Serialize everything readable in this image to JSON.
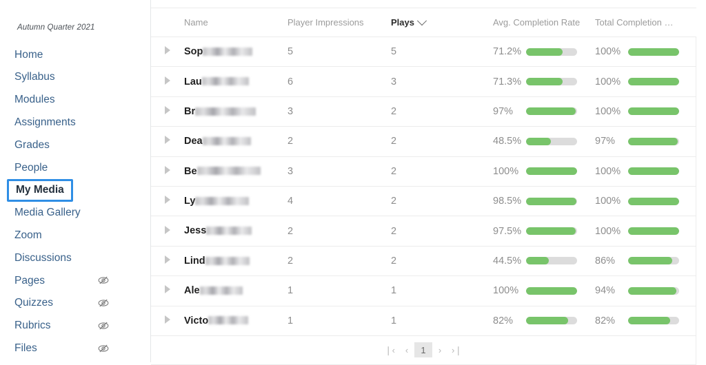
{
  "sidebar": {
    "term_label": "Autumn Quarter 2021",
    "items": [
      {
        "label": "Home",
        "hidden_icon": "",
        "active": false
      },
      {
        "label": "Syllabus",
        "hidden_icon": "",
        "active": false
      },
      {
        "label": "Modules",
        "hidden_icon": "",
        "active": false
      },
      {
        "label": "Assignments",
        "hidden_icon": "",
        "active": false
      },
      {
        "label": "Grades",
        "hidden_icon": "",
        "active": false
      },
      {
        "label": "People",
        "hidden_icon": "",
        "active": false
      },
      {
        "label": "My Media",
        "hidden_icon": "",
        "active": true
      },
      {
        "label": "Media Gallery",
        "hidden_icon": "",
        "active": false
      },
      {
        "label": "Zoom",
        "hidden_icon": "",
        "active": false
      },
      {
        "label": "Discussions",
        "hidden_icon": "",
        "active": false
      },
      {
        "label": "Pages",
        "hidden_icon": "eye-slash-icon",
        "active": false
      },
      {
        "label": "Quizzes",
        "hidden_icon": "eye-slash-icon",
        "active": false
      },
      {
        "label": "Rubrics",
        "hidden_icon": "eye-slash-icon",
        "active": false
      },
      {
        "label": "Files",
        "hidden_icon": "eye-slash-icon",
        "active": false
      }
    ]
  },
  "table": {
    "columns": [
      {
        "key": "toggle",
        "label": "",
        "sorted": false
      },
      {
        "key": "name",
        "label": "Name",
        "sorted": false
      },
      {
        "key": "impressions",
        "label": "Player Impressions",
        "sorted": false
      },
      {
        "key": "plays",
        "label": "Plays",
        "sorted": true,
        "sort_icon": "chevron-down-icon"
      },
      {
        "key": "avg",
        "label": "Avg. Completion Rate",
        "sorted": false
      },
      {
        "key": "total",
        "label": "Total Completion …",
        "sorted": false
      }
    ],
    "rows": [
      {
        "toggle_icon": "expand-triangle-icon",
        "name_visible": "Sop",
        "name_redacted_width": 72,
        "impressions": "5",
        "plays": "5",
        "avg_completion": "71.2%",
        "avg_value": 71.2,
        "total_completion": "100%",
        "total_value": 100
      },
      {
        "toggle_icon": "expand-triangle-icon",
        "name_visible": "Lau",
        "name_redacted_width": 68,
        "impressions": "6",
        "plays": "3",
        "avg_completion": "71.3%",
        "avg_value": 71.3,
        "total_completion": "100%",
        "total_value": 100
      },
      {
        "toggle_icon": "expand-triangle-icon",
        "name_visible": "Br",
        "name_redacted_width": 88,
        "impressions": "3",
        "plays": "2",
        "avg_completion": "97%",
        "avg_value": 97,
        "total_completion": "100%",
        "total_value": 100
      },
      {
        "toggle_icon": "expand-triangle-icon",
        "name_visible": "Dea",
        "name_redacted_width": 70,
        "impressions": "2",
        "plays": "2",
        "avg_completion": "48.5%",
        "avg_value": 48.5,
        "total_completion": "97%",
        "total_value": 97
      },
      {
        "toggle_icon": "expand-triangle-icon",
        "name_visible": "Be",
        "name_redacted_width": 92,
        "impressions": "3",
        "plays": "2",
        "avg_completion": "100%",
        "avg_value": 100,
        "total_completion": "100%",
        "total_value": 100
      },
      {
        "toggle_icon": "expand-triangle-icon",
        "name_visible": "Ly",
        "name_redacted_width": 78,
        "impressions": "4",
        "plays": "2",
        "avg_completion": "98.5%",
        "avg_value": 98.5,
        "total_completion": "100%",
        "total_value": 100
      },
      {
        "toggle_icon": "expand-triangle-icon",
        "name_visible": "Jess",
        "name_redacted_width": 66,
        "impressions": "2",
        "plays": "2",
        "avg_completion": "97.5%",
        "avg_value": 97.5,
        "total_completion": "100%",
        "total_value": 100
      },
      {
        "toggle_icon": "expand-triangle-icon",
        "name_visible": "Lind",
        "name_redacted_width": 64,
        "impressions": "2",
        "plays": "2",
        "avg_completion": "44.5%",
        "avg_value": 44.5,
        "total_completion": "86%",
        "total_value": 86
      },
      {
        "toggle_icon": "expand-triangle-icon",
        "name_visible": "Ale",
        "name_redacted_width": 62,
        "impressions": "1",
        "plays": "1",
        "avg_completion": "100%",
        "avg_value": 100,
        "total_completion": "94%",
        "total_value": 94
      },
      {
        "toggle_icon": "expand-triangle-icon",
        "name_visible": "Victo",
        "name_redacted_width": 58,
        "impressions": "1",
        "plays": "1",
        "avg_completion": "82%",
        "avg_value": 82,
        "total_completion": "82%",
        "total_value": 82
      }
    ]
  },
  "pagination": {
    "first_label": "❘‹",
    "prev_label": "‹",
    "current_page": "1",
    "next_label": "›",
    "last_label": "›❘"
  },
  "colors": {
    "accent_blue": "#2f8ee5",
    "link_blue": "#39618a",
    "bar_green": "#78c46a",
    "bar_track": "#dcdcdc",
    "border": "#ececec"
  }
}
